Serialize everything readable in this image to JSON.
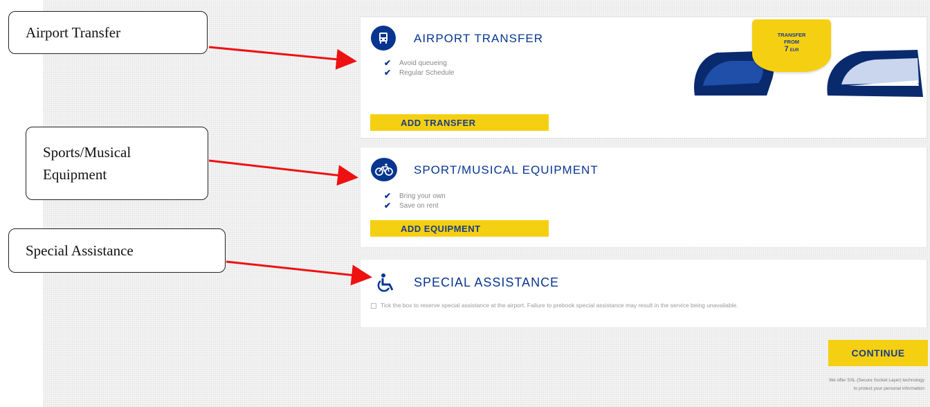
{
  "annotations": {
    "transfer_label": "Airport Transfer",
    "equipment_label_line1": "Sports/Musical",
    "equipment_label_line2": "Equipment",
    "assistance_label": "Special Assistance"
  },
  "transfer": {
    "title": "AIRPORT TRANSFER",
    "items": [
      "Avoid queueing",
      "Regular Schedule"
    ],
    "button": "ADD TRANSFER",
    "badge_line1": "TRANSFER",
    "badge_line2": "FROM",
    "badge_price": "7",
    "badge_currency": "EUR"
  },
  "equipment": {
    "title": "SPORT/MUSICAL EQUIPMENT",
    "items": [
      "Bring your own",
      "Save on rent"
    ],
    "button": "ADD EQUIPMENT"
  },
  "assistance": {
    "title": "SPECIAL ASSISTANCE",
    "description": "Tick the box to reserve special assistance at the airport. Failure to prebook special assistance may result in the service being unavailable."
  },
  "footer": {
    "continue": "CONTINUE",
    "secure_line1": "We offer SSL (Secure Socket Layer) technology",
    "secure_line2": "to protect your personal information"
  },
  "colors": {
    "brand_blue": "#073590",
    "yellow": "#f5d012",
    "arrow_red": "#ee1111"
  },
  "icons": {
    "transfer": "bus-icon",
    "equipment": "bicycle-icon",
    "assistance": "wheelchair-icon"
  }
}
